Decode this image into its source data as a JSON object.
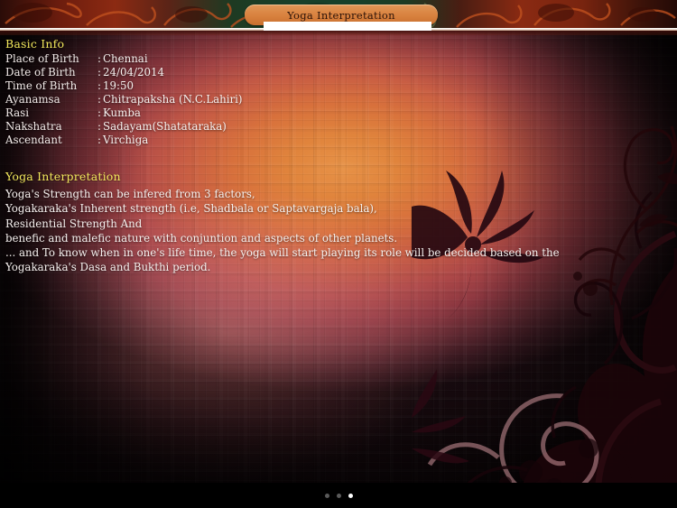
{
  "header": {
    "title": "Yoga Interpretation"
  },
  "basic_info": {
    "heading": "Basic Info",
    "separator": ":",
    "rows": [
      {
        "label": "Place of Birth",
        "value": "Chennai"
      },
      {
        "label": "Date of Birth",
        "value": "24/04/2014"
      },
      {
        "label": "Time of Birth",
        "value": "19:50"
      },
      {
        "label": "Ayanamsa",
        "value": "Chitrapaksha (N.C.Lahiri)"
      },
      {
        "label": "Rasi",
        "value": "Kumba"
      },
      {
        "label": "Nakshatra",
        "value": "Sadayam(Shatataraka)"
      },
      {
        "label": "Ascendant",
        "value": "Virchiga"
      }
    ]
  },
  "yoga": {
    "heading": "Yoga Interpretation",
    "lines": [
      "Yoga's Strength can be infered from 3 factors,",
      "Yogakaraka's Inherent strength (i.e, Shadbala or Saptavargaja bala),",
      "Residential Strength And",
      "benefic and malefic nature with conjuntion and aspects of other planets.",
      "...  and To know when in one's life time, the yoga will start playing its role will be decided based on the",
      "Yogakaraka's Dasa and Bukthi period."
    ]
  },
  "footer": {
    "page_dots": [
      {
        "active": false
      },
      {
        "active": false
      },
      {
        "active": true
      }
    ]
  },
  "colors": {
    "heading": "#f2e85c",
    "body_text": "#f6f1ef",
    "tab_orange": "#d9823f",
    "tab_text": "#2b1208",
    "header_green": "#16402a",
    "header_red": "#8a2a12",
    "footer_black": "#000000",
    "dot_active": "#ffffff",
    "dot_inactive": "#5a5a5a"
  }
}
